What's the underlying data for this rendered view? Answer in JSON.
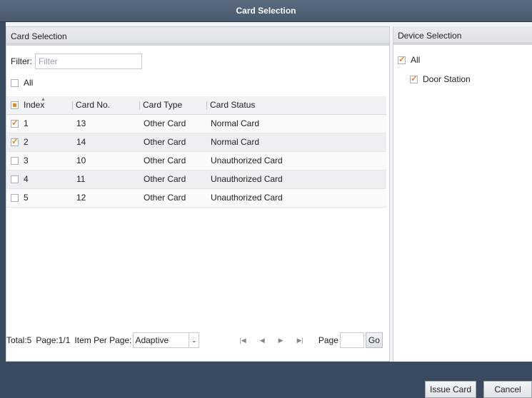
{
  "window": {
    "title": "Card Selection"
  },
  "card_panel": {
    "header": "Card Selection",
    "filter_label": "Filter:",
    "filter_placeholder": "Filter",
    "all_label": "All",
    "columns": [
      "Index",
      "Card No.",
      "Card Type",
      "Card Status"
    ],
    "rows": [
      {
        "index": "1",
        "card_no": "13",
        "card_type": "Other Card",
        "card_status": "Normal Card",
        "checked": true
      },
      {
        "index": "2",
        "card_no": "14",
        "card_type": "Other Card",
        "card_status": "Normal Card",
        "checked": true
      },
      {
        "index": "3",
        "card_no": "10",
        "card_type": "Other Card",
        "card_status": "Unauthorized Card",
        "checked": false
      },
      {
        "index": "4",
        "card_no": "11",
        "card_type": "Other Card",
        "card_status": "Unauthorized Card",
        "checked": false
      },
      {
        "index": "5",
        "card_no": "12",
        "card_type": "Other Card",
        "card_status": "Unauthorized Card",
        "checked": false
      }
    ],
    "footer": {
      "total": "Total:5",
      "page_info": "Page:1/1",
      "items_per_page_label": "Item Per Page:",
      "items_per_page_value": "Adaptive",
      "page_label": "Page",
      "go_label": "Go"
    }
  },
  "device_panel": {
    "header": "Device Selection",
    "all_label": "All",
    "devices": [
      "Door Station"
    ]
  },
  "buttons": {
    "issue_card": "Issue Card",
    "cancel": "Cancel"
  },
  "colors": {
    "check_accent": "#e8891c",
    "titlebar": "#4a5a6e"
  }
}
